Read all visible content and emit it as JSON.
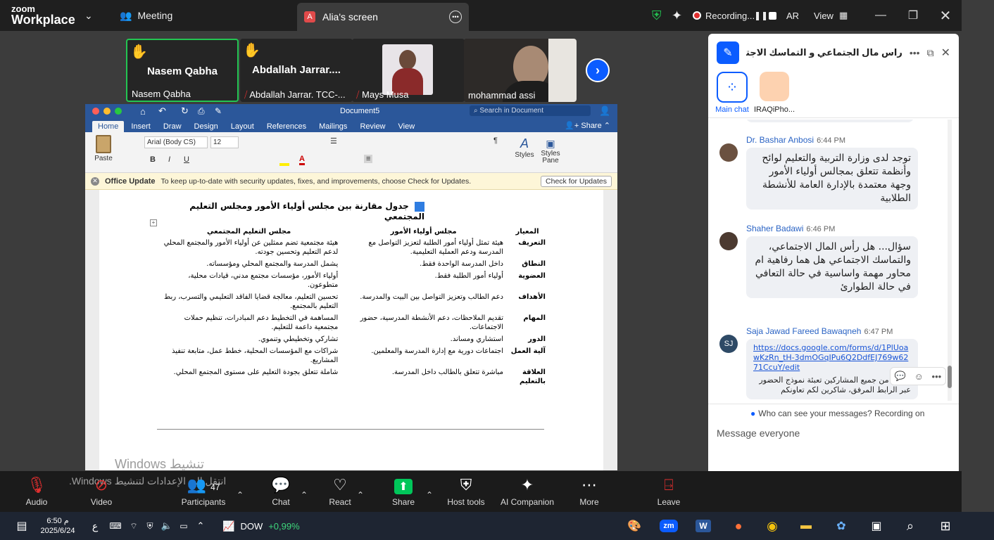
{
  "app": {
    "logo_top": "zoom",
    "logo_bottom": "Workplace"
  },
  "topbar": {
    "meeting_label": "Meeting",
    "screen_tab": "Alia's screen",
    "screen_tab_initial": "A",
    "recording_label": "Recording...",
    "lang": "AR",
    "view_label": "View"
  },
  "gallery": [
    {
      "big": "Nasem Qabha",
      "label": "Nasem Qabha",
      "hand": true
    },
    {
      "big": "Abdallah  Jarrar....",
      "label": "Abdallah Jarrar. TCC-...",
      "hand": true
    },
    {
      "big": "",
      "label": "Mays Musa",
      "hand": false
    },
    {
      "big": "",
      "label": "mohammad assi",
      "hand": false
    }
  ],
  "word": {
    "doc_title": "Document5",
    "search_placeholder": "Search in Document",
    "tabs": [
      "Home",
      "Insert",
      "Draw",
      "Design",
      "Layout",
      "References",
      "Mailings",
      "Review",
      "View"
    ],
    "share_label": "Share",
    "paste_label": "Paste",
    "font_name": "Arial (Body CS)",
    "font_size": "12",
    "styles_label": "Styles",
    "styles_pane_label": "Styles Pane",
    "update_title": "Office Update",
    "update_text": "To keep up-to-date with security updates, fixes, and improvements, choose Check for Updates.",
    "update_button": "Check for Updates",
    "doc_heading": "جدول مقارنة بين مجلس أولياء الأمور ومجلس التعليم المجتمعي",
    "table_header": [
      "المعيار",
      "مجلس أولياء الأمور",
      "مجلس التعليم المجتمعي"
    ],
    "rows": [
      [
        "التعريف",
        "هيئة تمثل أولياء أمور الطلبة لتعزيز التواصل مع المدرسة ودعم العملية التعليمية.",
        "هيئة مجتمعية تضم ممثلين عن أولياء الأمور والمجتمع المحلي لدعم التعليم وتحسين جودته."
      ],
      [
        "النطاق",
        "داخل المدرسة الواحدة فقط.",
        "يشمل المدرسة والمجتمع المحلي ومؤسساته."
      ],
      [
        "العضوية",
        "أولياء أمور الطلبة فقط.",
        "أولياء الأمور، مؤسسات مجتمع مدني، قيادات محلية، متطوعون."
      ],
      [
        "الأهداف",
        "دعم الطالب وتعزيز التواصل بين البيت والمدرسة.",
        "تحسين التعليم، معالجة قضايا الفاقد التعليمي والتسرب، ربط التعليم بالمجتمع."
      ],
      [
        "المهام",
        "تقديم الملاحظات، دعم الأنشطة المدرسية، حضور الاجتماعات.",
        "المساهمة في التخطيط دعم المبادرات، تنظيم حملات مجتمعية داعمة للتعليم."
      ],
      [
        "الدور",
        "استشاري ومساند.",
        "تشاركي وتخطيطي وتنموي."
      ],
      [
        "آلية العمل",
        "اجتماعات دورية مع إدارة المدرسة والمعلمين.",
        "شراكات مع المؤسسات المحلية، خطط عمل، متابعة تنفيذ المشاريع."
      ],
      [
        "العلاقة بالتعليم",
        "مباشرة تتعلق بالطالب داخل المدرسة.",
        "شاملة تتعلق بجودة التعليم على مستوى المجتمع المحلي."
      ]
    ],
    "watermark_1": "Windows تنشيط",
    "watermark_2": "انتقل إلى الإعدادات لتنشيط Windows."
  },
  "chat": {
    "title": "راس مال الجتماعي و التماسك الاجتما...",
    "channels": [
      {
        "label": "Main chat"
      },
      {
        "label": "IRAQiPho..."
      }
    ],
    "messages": [
      {
        "sender": "Dr. Bashar Anbosi",
        "time": "6:44 PM",
        "text": "توجد لدى وزارة التربية والتعليم لوائح وأنظمة تتعلق بمجالس أولياء الأمور وجهة معتمدة بالإدارة العامة للأنشطة الطلابية"
      },
      {
        "sender": "Shaher Badawi",
        "time": "6:46 PM",
        "text": "سؤال... هل رأس المال الاجتماعي، والتماسك الاجتماعي هل هما رفاهية ام محاور مهمة واساسية في حالة التعافي في حالة الطوارئ"
      },
      {
        "sender": "Saja Jawad Fareed Bawaqneh",
        "time": "6:47 PM",
        "initials": "SJ",
        "link": "https://docs.google.com/forms/d/1PlUoawKzRn_tH-3dmOGqIPu6Q2DdfEJ769w6271CcuY/edit",
        "text": "الرجاء من جميع المشاركين تعبئة نموذج الحضور عبر الرابط المرفق، شاكرين لكم تعاونكم"
      }
    ],
    "privacy_note": "Who can see your messages? Recording on",
    "input_placeholder": "Message everyone"
  },
  "toolbar": {
    "audio": "Audio",
    "video": "Video",
    "participants": "Participants",
    "participants_count": "47",
    "chat": "Chat",
    "react": "React",
    "share": "Share",
    "host_tools": "Host tools",
    "ai": "AI Companion",
    "more": "More",
    "leave": "Leave"
  },
  "taskbar": {
    "time": "6:50 م",
    "date": "2025/6/24",
    "lang": "ع",
    "dow_label": "DOW",
    "dow_change": "+0,99%"
  },
  "colors": {
    "zoom_blue": "#0b5cff",
    "word_blue": "#2b579a",
    "share_green": "#00c65a",
    "dow_green": "#3ed77c"
  }
}
